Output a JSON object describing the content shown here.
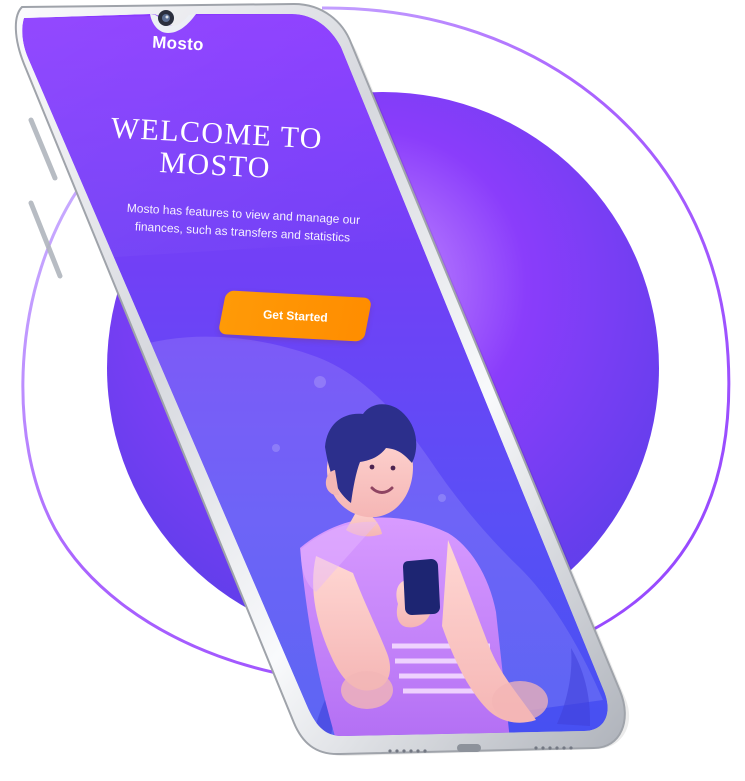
{
  "phone_screen": {
    "brand": "Mosto",
    "headline_line1": "WELCOME TO",
    "headline_line2": "MOSTO",
    "subtitle_line1": "Mosto has features to view and manage our",
    "subtitle_line2": "finances, such as transfers and statistics",
    "cta_label": "Get Started"
  },
  "colors": {
    "primary_purple": "#7A35F6",
    "secondary_blue": "#4E59F5",
    "cta_orange": "#FF8F00",
    "white": "#FFFFFF"
  },
  "icons": {
    "camera": "front-camera-icon",
    "speaker": "speaker-grille-icon",
    "port": "charging-port-icon",
    "phone_in_hand": "phone-icon"
  }
}
